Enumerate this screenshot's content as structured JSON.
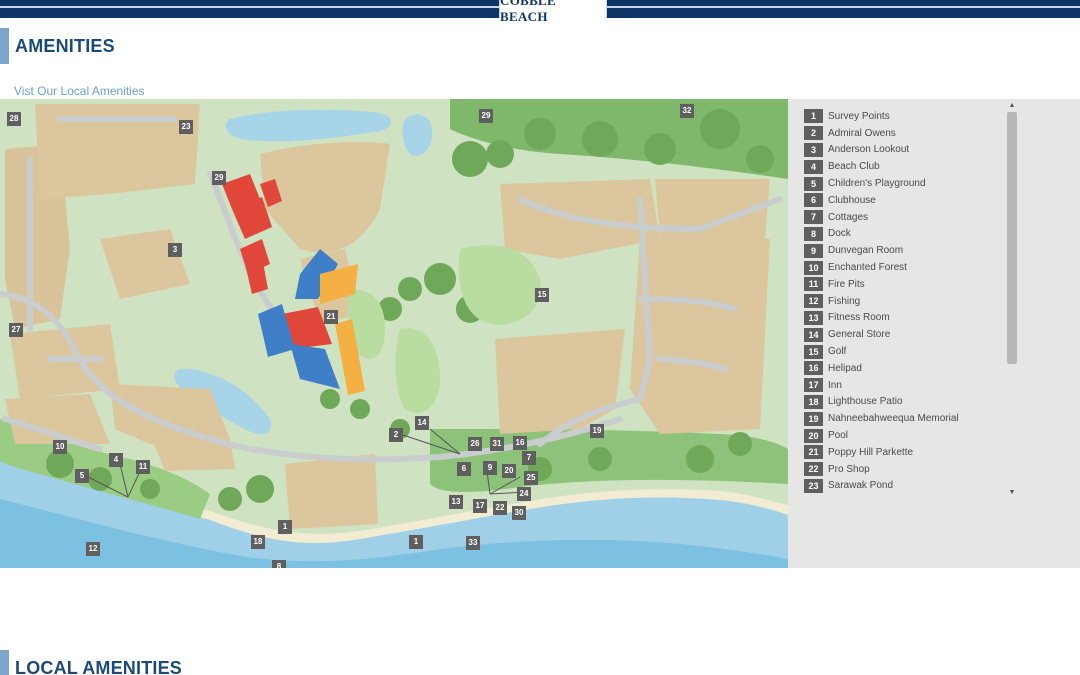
{
  "brand": {
    "logo_text": "COBBLE BEACH"
  },
  "header": {
    "title": "AMENITIES",
    "link_text": "Vist Our Local Amenities"
  },
  "colors": {
    "navy": "#0e3566",
    "accent_bar": "#7aa6cc",
    "title": "#1a4a78",
    "link": "#6ea0c8",
    "badge": "#5f5f5f"
  },
  "map": {
    "pins": [
      {
        "id": "p28",
        "label": "28"
      },
      {
        "id": "p23",
        "label": "23"
      },
      {
        "id": "p29a",
        "label": "29"
      },
      {
        "id": "p29b",
        "label": "29"
      },
      {
        "id": "p32",
        "label": "32"
      },
      {
        "id": "p3",
        "label": "3"
      },
      {
        "id": "p15",
        "label": "15"
      },
      {
        "id": "p27",
        "label": "27"
      },
      {
        "id": "p21",
        "label": "21"
      },
      {
        "id": "p14",
        "label": "14"
      },
      {
        "id": "p2",
        "label": "2"
      },
      {
        "id": "p26",
        "label": "26"
      },
      {
        "id": "p31",
        "label": "31"
      },
      {
        "id": "p16",
        "label": "16"
      },
      {
        "id": "p19",
        "label": "19"
      },
      {
        "id": "p7",
        "label": "7"
      },
      {
        "id": "p10",
        "label": "10"
      },
      {
        "id": "p4",
        "label": "4"
      },
      {
        "id": "p11",
        "label": "11"
      },
      {
        "id": "p5",
        "label": "5"
      },
      {
        "id": "p6",
        "label": "6"
      },
      {
        "id": "p9",
        "label": "9"
      },
      {
        "id": "p20",
        "label": "20"
      },
      {
        "id": "p25",
        "label": "25"
      },
      {
        "id": "p24",
        "label": "24"
      },
      {
        "id": "p13",
        "label": "13"
      },
      {
        "id": "p17",
        "label": "17"
      },
      {
        "id": "p22",
        "label": "22"
      },
      {
        "id": "p30",
        "label": "30"
      },
      {
        "id": "p1a",
        "label": "1"
      },
      {
        "id": "p18",
        "label": "18"
      },
      {
        "id": "p1b",
        "label": "1"
      },
      {
        "id": "p33",
        "label": "33"
      },
      {
        "id": "p12",
        "label": "12"
      },
      {
        "id": "p8",
        "label": "8"
      }
    ]
  },
  "amenities": [
    {
      "num": "1",
      "label": "Survey Points"
    },
    {
      "num": "2",
      "label": "Admiral Owens"
    },
    {
      "num": "3",
      "label": "Anderson Lookout"
    },
    {
      "num": "4",
      "label": "Beach Club"
    },
    {
      "num": "5",
      "label": "Children's Playground"
    },
    {
      "num": "6",
      "label": "Clubhouse"
    },
    {
      "num": "7",
      "label": "Cottages"
    },
    {
      "num": "8",
      "label": "Dock"
    },
    {
      "num": "9",
      "label": "Dunvegan Room"
    },
    {
      "num": "10",
      "label": "Enchanted Forest"
    },
    {
      "num": "11",
      "label": "Fire Pits"
    },
    {
      "num": "12",
      "label": "Fishing"
    },
    {
      "num": "13",
      "label": "Fitness Room"
    },
    {
      "num": "14",
      "label": "General Store"
    },
    {
      "num": "15",
      "label": "Golf"
    },
    {
      "num": "16",
      "label": "Helipad"
    },
    {
      "num": "17",
      "label": "Inn"
    },
    {
      "num": "18",
      "label": "Lighthouse Patio"
    },
    {
      "num": "19",
      "label": "Nahneebahweequa Memorial"
    },
    {
      "num": "20",
      "label": "Pool"
    },
    {
      "num": "21",
      "label": "Poppy Hill Parkette"
    },
    {
      "num": "22",
      "label": "Pro Shop"
    },
    {
      "num": "23",
      "label": "Sarawak Pond"
    }
  ],
  "local": {
    "title": "LOCAL AMENITIES"
  },
  "scroll": {
    "up_icon": "▲",
    "down_icon": "▼"
  }
}
